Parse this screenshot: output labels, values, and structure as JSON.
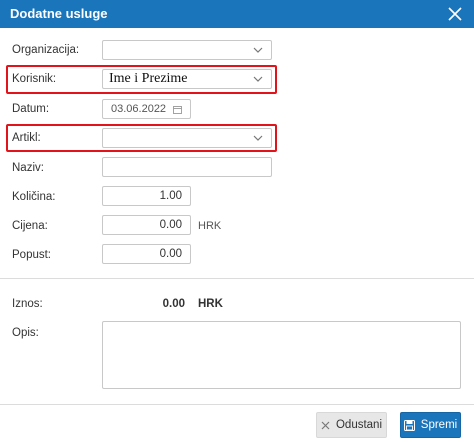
{
  "dialog": {
    "title": "Dodatne usluge",
    "close_icon": "close-icon"
  },
  "form": {
    "organizacija": {
      "label": "Organizacija:",
      "value": ""
    },
    "korisnik": {
      "label": "Korisnik:",
      "value": "Ime i Prezime"
    },
    "datum": {
      "label": "Datum:",
      "value": "03.06.2022",
      "icon": "calendar-icon"
    },
    "artikl": {
      "label": "Artikl:",
      "value": ""
    },
    "naziv": {
      "label": "Naziv:",
      "value": ""
    },
    "kolicina": {
      "label": "Količina:",
      "value": "1.00"
    },
    "cijena": {
      "label": "Cijena:",
      "value": "0.00",
      "unit": "HRK"
    },
    "popust": {
      "label": "Popust:",
      "value": "0.00"
    },
    "iznos": {
      "label": "Iznos:",
      "value": "0.00",
      "unit": "HRK"
    },
    "opis": {
      "label": "Opis:",
      "value": ""
    }
  },
  "footer": {
    "cancel_label": "Odustani",
    "save_label": "Spremi"
  },
  "colors": {
    "header_bg": "#1b75bb",
    "highlight": "#e0141a",
    "primary_button": "#1b75bb"
  }
}
